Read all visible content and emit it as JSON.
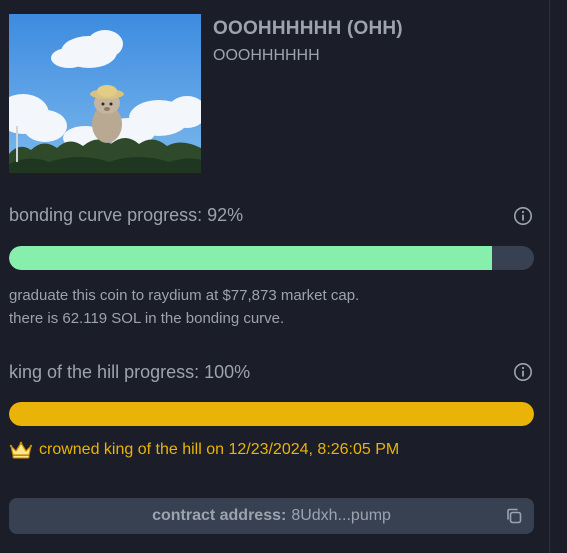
{
  "token": {
    "name": "OOOHHHHHH (OHH)",
    "ticker": "OOOHHHHHH",
    "image_icon": "bear-plush-sky-photo"
  },
  "bonding_curve": {
    "label": "bonding curve progress: 92%",
    "progress": 0.92,
    "fill_color": "#86efac",
    "description_line1": "graduate this coin to raydium at $77,873 market cap.",
    "description_line2": "there is 62.119 SOL in the bonding curve."
  },
  "king_of_hill": {
    "label": "king of the hill progress: 100%",
    "progress": 1.0,
    "fill_color": "#eab308",
    "crowned_icon": "crown-icon",
    "crowned_text": "crowned king of the hill on 12/23/2024, 8:26:05 PM"
  },
  "contract": {
    "label": "contract address:",
    "value": "8Udxh...pump",
    "copy_icon": "copy-icon"
  },
  "colors": {
    "background": "#1b1d28",
    "track": "#374151",
    "text_muted": "#9ca3af",
    "accent_green": "#86efac",
    "accent_gold": "#eab308"
  }
}
